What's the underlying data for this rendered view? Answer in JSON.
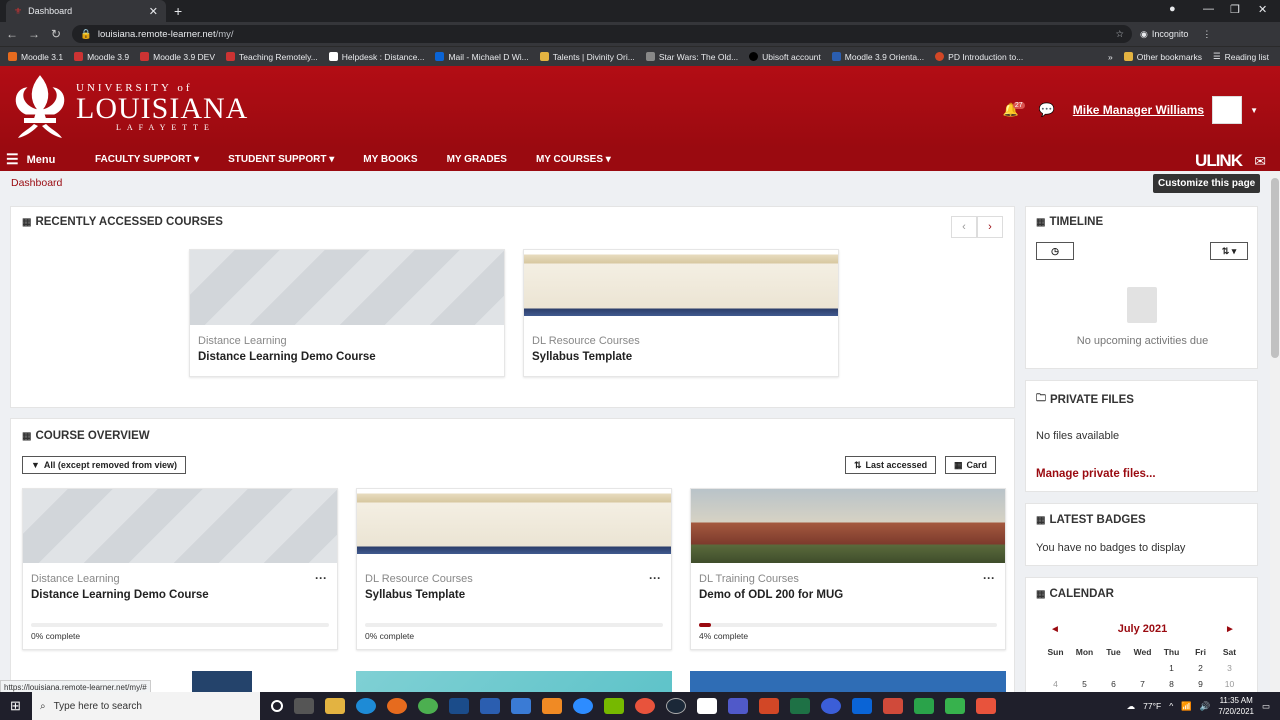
{
  "browser": {
    "tab_title": "Dashboard",
    "url_host": "louisiana.remote-learner.net",
    "url_path": "/my/",
    "incognito": "Incognito",
    "bookmarks": [
      "Moodle 3.1",
      "Moodle 3.9",
      "Moodle 3.9 DEV",
      "Teaching Remotely...",
      "Helpdesk : Distance...",
      "Mail - Michael D Wi...",
      "Talents | Divinity Ori...",
      "Star Wars: The Old...",
      "Ubisoft account",
      "Moodle 3.9 Orienta...",
      "PD Introduction to..."
    ],
    "other_bookmarks": "Other bookmarks",
    "reading_list": "Reading list",
    "status_url": "https://louisiana.remote-learner.net/my/#"
  },
  "header": {
    "logo_university": "UNIVERSITY of",
    "logo_name": "LOUISIANA",
    "logo_campus": "LAFAYETTE",
    "notif_count": "27",
    "user_name": "Mike Manager Williams"
  },
  "nav": {
    "menu": "Menu",
    "items": [
      "FACULTY SUPPORT",
      "STUDENT SUPPORT",
      "MY BOOKS",
      "MY GRADES",
      "MY COURSES"
    ],
    "ulink": "ULINK"
  },
  "breadcrumb": "Dashboard",
  "customize": "Customize this page",
  "recent": {
    "title": "RECENTLY ACCESSED COURSES",
    "courses": [
      {
        "category": "Distance Learning",
        "name": "Distance Learning Demo Course"
      },
      {
        "category": "DL Resource Courses",
        "name": "Syllabus Template"
      }
    ]
  },
  "overview": {
    "title": "COURSE OVERVIEW",
    "filter": "All (except removed from view)",
    "sort": "Last accessed",
    "view": "Card",
    "courses": [
      {
        "category": "Distance Learning",
        "name": "Distance Learning Demo Course",
        "progress": 0,
        "progress_label": "0% complete"
      },
      {
        "category": "DL Resource Courses",
        "name": "Syllabus Template",
        "progress": 0,
        "progress_label": "0% complete"
      },
      {
        "category": "DL Training Courses",
        "name": "Demo of ODL 200 for MUG",
        "progress": 4,
        "progress_label": "4% complete"
      }
    ]
  },
  "timeline": {
    "title": "TIMELINE",
    "empty": "No upcoming activities due"
  },
  "files": {
    "title": "PRIVATE FILES",
    "empty": "No files available",
    "manage": "Manage private files..."
  },
  "badges": {
    "title": "LATEST BADGES",
    "empty": "You have no badges to display"
  },
  "calendar": {
    "title": "CALENDAR",
    "month": "July 2021",
    "days": [
      "Sun",
      "Mon",
      "Tue",
      "Wed",
      "Thu",
      "Fri",
      "Sat"
    ],
    "week1": [
      "",
      "",
      "",
      "",
      "1",
      "2",
      "3"
    ],
    "week2": [
      "4",
      "5",
      "6",
      "7",
      "8",
      "9",
      "10"
    ]
  },
  "taskbar": {
    "search": "Type here to search",
    "temp": "77°F",
    "time": "11:35 AM",
    "date": "7/20/2021"
  }
}
